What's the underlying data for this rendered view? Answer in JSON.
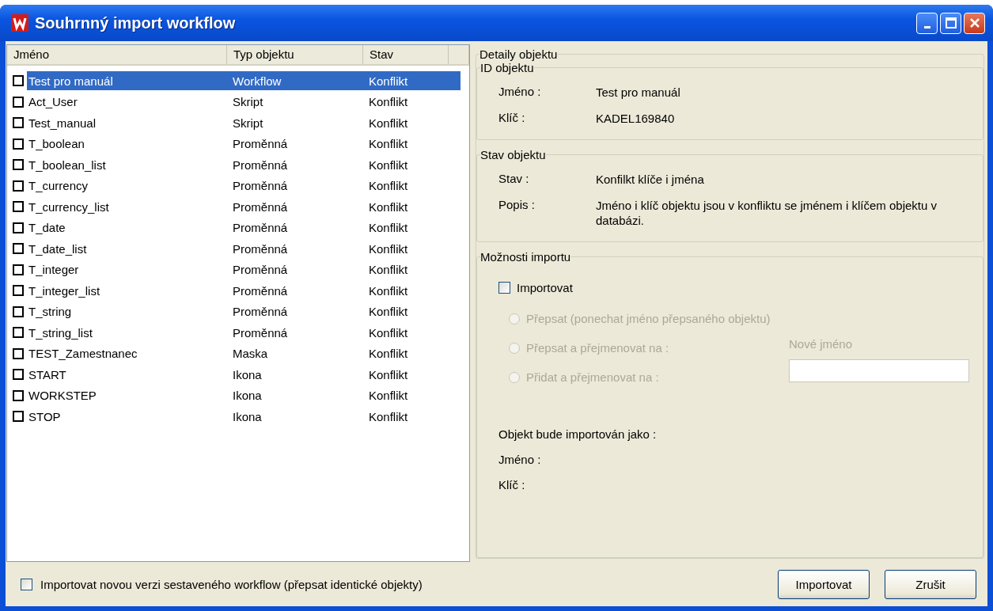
{
  "window": {
    "title": "Souhrnný import workflow"
  },
  "list": {
    "columns": [
      "Jméno",
      "Typ objektu",
      "Stav"
    ],
    "rows": [
      {
        "name": "Test pro manuál",
        "type": "Workflow",
        "status": "Konflikt",
        "checked": false,
        "selected": true
      },
      {
        "name": "Act_User",
        "type": "Skript",
        "status": "Konflikt",
        "checked": false,
        "selected": false
      },
      {
        "name": "Test_manual",
        "type": "Skript",
        "status": "Konflikt",
        "checked": false,
        "selected": false
      },
      {
        "name": "T_boolean",
        "type": "Proměnná",
        "status": "Konflikt",
        "checked": false,
        "selected": false
      },
      {
        "name": "T_boolean_list",
        "type": "Proměnná",
        "status": "Konflikt",
        "checked": false,
        "selected": false
      },
      {
        "name": "T_currency",
        "type": "Proměnná",
        "status": "Konflikt",
        "checked": false,
        "selected": false
      },
      {
        "name": "T_currency_list",
        "type": "Proměnná",
        "status": "Konflikt",
        "checked": false,
        "selected": false
      },
      {
        "name": "T_date",
        "type": "Proměnná",
        "status": "Konflikt",
        "checked": false,
        "selected": false
      },
      {
        "name": "T_date_list",
        "type": "Proměnná",
        "status": "Konflikt",
        "checked": false,
        "selected": false
      },
      {
        "name": "T_integer",
        "type": "Proměnná",
        "status": "Konflikt",
        "checked": false,
        "selected": false
      },
      {
        "name": "T_integer_list",
        "type": "Proměnná",
        "status": "Konflikt",
        "checked": false,
        "selected": false
      },
      {
        "name": "T_string",
        "type": "Proměnná",
        "status": "Konflikt",
        "checked": false,
        "selected": false
      },
      {
        "name": "T_string_list",
        "type": "Proměnná",
        "status": "Konflikt",
        "checked": false,
        "selected": false
      },
      {
        "name": "TEST_Zamestnanec",
        "type": "Maska",
        "status": "Konflikt",
        "checked": false,
        "selected": false
      },
      {
        "name": "START",
        "type": "Ikona",
        "status": "Konflikt",
        "checked": false,
        "selected": false
      },
      {
        "name": "WORKSTEP",
        "type": "Ikona",
        "status": "Konflikt",
        "checked": false,
        "selected": false
      },
      {
        "name": "STOP",
        "type": "Ikona",
        "status": "Konflikt",
        "checked": false,
        "selected": false
      }
    ]
  },
  "details": {
    "title": "Detaily objektu",
    "id_group": {
      "title": "ID objektu",
      "fields": [
        {
          "label": "Jméno :",
          "value": "Test pro manuál"
        },
        {
          "label": "Klíč :",
          "value": "KADEL169840"
        }
      ]
    },
    "status_group": {
      "title": "Stav objektu",
      "fields": [
        {
          "label": "Stav :",
          "value": "Konfilkt klíče i jména"
        },
        {
          "label": "Popis :",
          "value": "Jméno i klíč objektu jsou v konfliktu se jménem i klíčem objektu v databázi."
        }
      ]
    },
    "import_group": {
      "title": "Možnosti importu",
      "import_checkbox": {
        "label": "Importovat",
        "checked": false
      },
      "options": [
        {
          "label": "Přepsat (ponechat jméno přepsaného objektu)",
          "selected": false,
          "disabled": true
        },
        {
          "label": "Přepsat a přejmenovat na :",
          "selected": false,
          "disabled": true
        },
        {
          "label": "Přidat a přejmenovat na :",
          "selected": false,
          "disabled": true
        }
      ],
      "new_name": {
        "label": "Nové jméno",
        "disabled": true
      },
      "result_title": "Objekt bude importován jako :",
      "result_fields": [
        {
          "label": "Jméno :"
        },
        {
          "label": "Klíč :"
        }
      ]
    }
  },
  "footer": {
    "checkbox": {
      "label": "Importovat novou verzi sestaveného workflow (přepsat identické objekty)",
      "checked": false
    },
    "buttons": [
      "Importovat",
      "Zrušit"
    ]
  }
}
